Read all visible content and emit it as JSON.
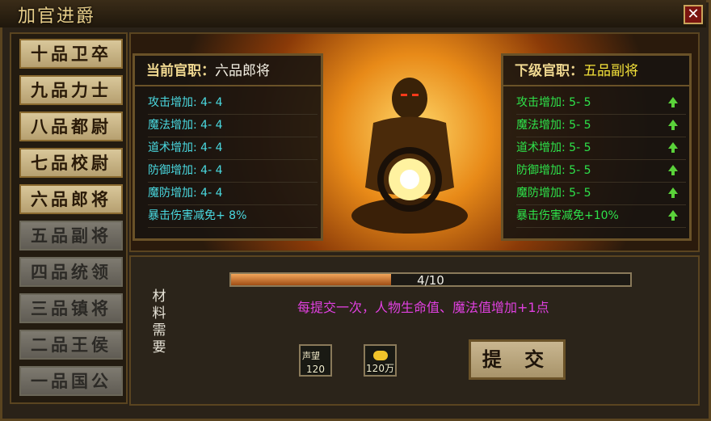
{
  "window": {
    "title": "加官进爵",
    "close_label": "✕"
  },
  "ranks": [
    {
      "label": "十品卫卒",
      "locked": false
    },
    {
      "label": "九品力士",
      "locked": false
    },
    {
      "label": "八品都尉",
      "locked": false
    },
    {
      "label": "七品校尉",
      "locked": false
    },
    {
      "label": "六品郎将",
      "locked": false
    },
    {
      "label": "五品副将",
      "locked": true
    },
    {
      "label": "四品统领",
      "locked": true
    },
    {
      "label": "三品镇将",
      "locked": true
    },
    {
      "label": "二品王侯",
      "locked": true
    },
    {
      "label": "一品国公",
      "locked": true
    }
  ],
  "current": {
    "label": "当前官职：",
    "value": "六品郎将",
    "stats": [
      "攻击增加: 4- 4",
      "魔法增加: 4- 4",
      "道术增加: 4- 4",
      "防御增加: 4- 4",
      "魔防增加: 4- 4",
      "暴击伤害减免+ 8%"
    ]
  },
  "next": {
    "label": "下级官职：",
    "value": "五品副将",
    "stats": [
      "攻击增加: 5- 5",
      "魔法增加: 5- 5",
      "道术增加: 5- 5",
      "防御增加: 5- 5",
      "魔防增加: 5- 5",
      "暴击伤害减免+10%"
    ]
  },
  "progress": {
    "text": "4/10",
    "fraction": 0.4
  },
  "hint": "每提交一次，人物生命值、魔法值增加+1点",
  "materials": {
    "label": "材料需要",
    "items": [
      {
        "icon_text": "声望",
        "qty": "120"
      },
      {
        "qty": "120万"
      }
    ]
  },
  "submit_label": "提 交",
  "colors": {
    "current_stat": "#4ad9e0",
    "next_stat": "#2ee24a",
    "hint": "#e040e0",
    "next_value": "#f4e23a"
  }
}
